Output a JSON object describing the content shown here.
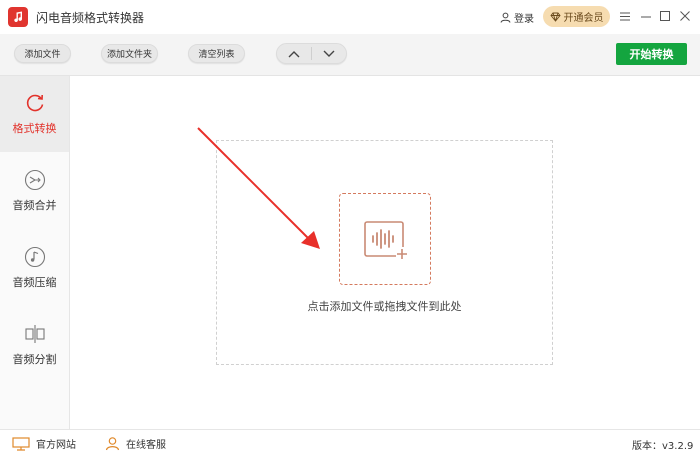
{
  "app": {
    "title": "闪电音频格式转换器",
    "accent_color": "#e2322b",
    "logo_icon": "music-note-icon"
  },
  "header": {
    "login_label": "登录",
    "vip_label": "开通会员",
    "menu_icon": "hamburger-icon",
    "minimize_icon": "minimize-icon",
    "maximize_icon": "maximize-icon",
    "close_icon": "close-icon"
  },
  "toolbar": {
    "add_file_label": "添加文件",
    "add_folder_label": "添加文件夹",
    "clear_list_label": "清空列表",
    "move_up_icon": "chevron-up-icon",
    "move_down_icon": "chevron-down-icon",
    "start_label": "开始转换",
    "start_color": "#14a53f"
  },
  "sidebar": {
    "items": [
      {
        "label": "格式转换",
        "icon": "refresh-icon",
        "active": true
      },
      {
        "label": "音频合并",
        "icon": "merge-icon",
        "active": false
      },
      {
        "label": "音频压缩",
        "icon": "music-compress-icon",
        "active": false
      },
      {
        "label": "音频分割",
        "icon": "split-icon",
        "active": false
      }
    ]
  },
  "main": {
    "drop_hint": "点击添加文件或拖拽文件到此处",
    "add_icon": "add-audio-icon"
  },
  "statusbar": {
    "website_label": "官方网站",
    "support_label": "在线客服",
    "version_label": "版本：v3.2.9"
  }
}
